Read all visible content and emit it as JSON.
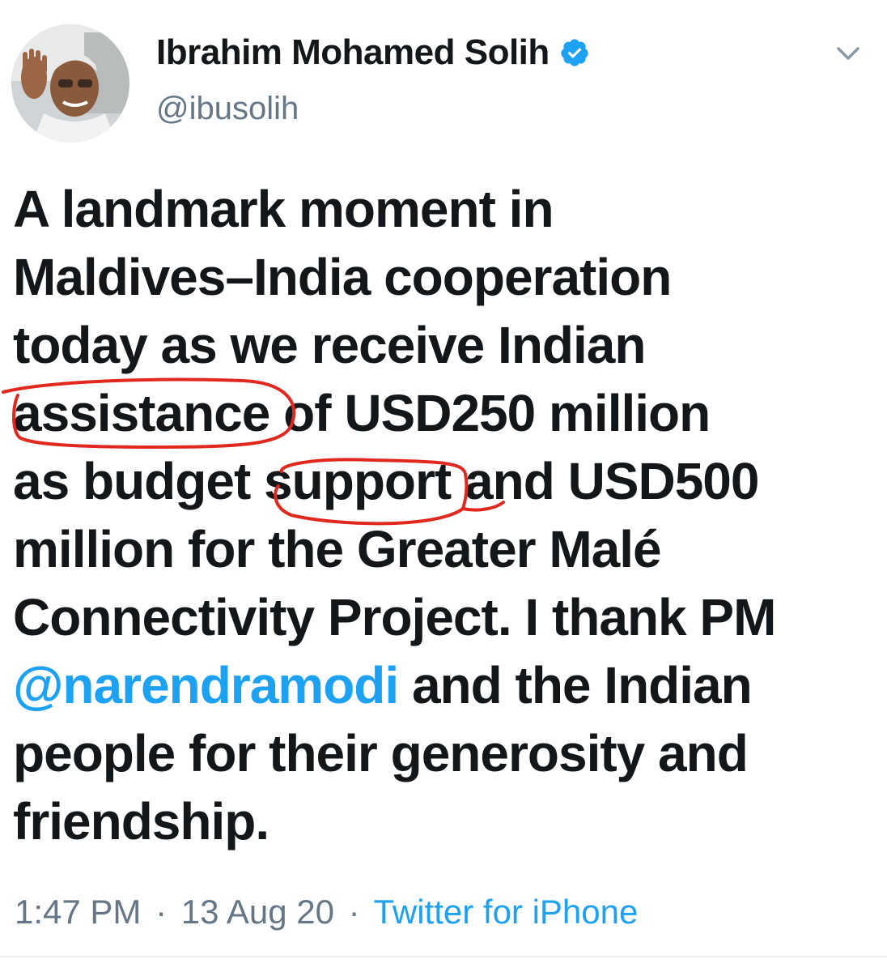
{
  "author": {
    "name": "Ibrahim Mohamed Solih",
    "handle": "@ibusolih",
    "verified": true,
    "avatar_icon": "avatar-photo"
  },
  "tweet": {
    "lines": {
      "l1": "A landmark moment in",
      "l2": "Maldives–India cooperation",
      "l3": "today as we receive Indian",
      "l4a": "assistance",
      "l4b": " of USD250 million",
      "l5a": "as budget ",
      "l5b": "support",
      "l5c": " and USD500",
      "l6": "million for the Greater Malé",
      "l7": "Connectivity Project. I thank PM",
      "l8a": "@narendramodi",
      "l8b": " and the Indian",
      "l9": "people for their generosity and",
      "l10": "friendship."
    },
    "annotations": [
      "assistance",
      "support"
    ]
  },
  "meta": {
    "time": "1:47 PM",
    "separator": "·",
    "date": "13 Aug 20",
    "source": "Twitter for iPhone"
  },
  "colors": {
    "text": "#14171a",
    "muted": "#657786",
    "link": "#1da1f2",
    "annotation": "#e0281e"
  },
  "icons": [
    "verified-badge-icon",
    "chevron-down-icon"
  ]
}
